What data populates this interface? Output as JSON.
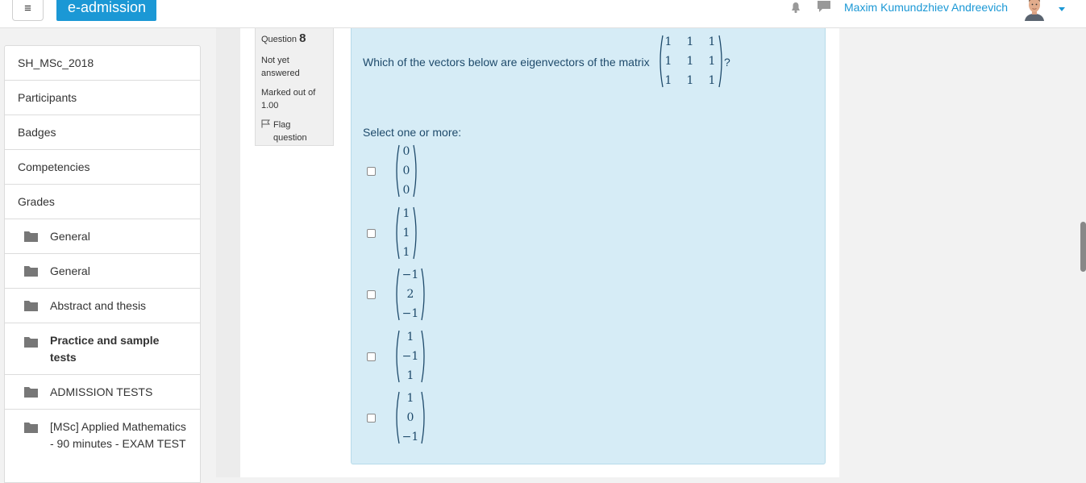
{
  "navbar": {
    "menu_icon": "hamburger-icon",
    "brand": "e-admission",
    "user_name": "Maxim Kumundzhiev Andreevich",
    "accent": "#1b98d5"
  },
  "drawer": {
    "items": [
      {
        "label": "SH_MSc_2018",
        "icon": ""
      },
      {
        "label": "Participants",
        "icon": ""
      },
      {
        "label": "Badges",
        "icon": ""
      },
      {
        "label": "Competencies",
        "icon": ""
      },
      {
        "label": "Grades",
        "icon": ""
      },
      {
        "label": "General",
        "icon": "folder-icon"
      },
      {
        "label": "General",
        "icon": "folder-icon"
      },
      {
        "label": "Abstract and thesis",
        "icon": "folder-icon"
      },
      {
        "label": "Practice and sample tests",
        "icon": "folder-icon"
      },
      {
        "label": "ADMISSION TESTS",
        "icon": "folder-icon"
      },
      {
        "label": "[MSc] Applied Mathematics - 90 minutes - EXAM TEST",
        "icon": "folder-icon"
      }
    ]
  },
  "question": {
    "label": "Question",
    "number": "8",
    "state": "Not yet answered",
    "grade": "Marked out of 1.00",
    "flag": "Flag question",
    "text": "Which of the vectors below are eigenvectors of the matrix",
    "text_end": "?",
    "matrix": [
      [
        "1",
        "1",
        "1"
      ],
      [
        "1",
        "1",
        "1"
      ],
      [
        "1",
        "1",
        "1"
      ]
    ],
    "prompt": "Select one or more:",
    "options": [
      [
        "0",
        "0",
        "0"
      ],
      [
        "1",
        "1",
        "1"
      ],
      [
        "−1",
        "2",
        "−1"
      ],
      [
        "1",
        "−1",
        "1"
      ],
      [
        "1",
        "0",
        "−1"
      ]
    ]
  }
}
